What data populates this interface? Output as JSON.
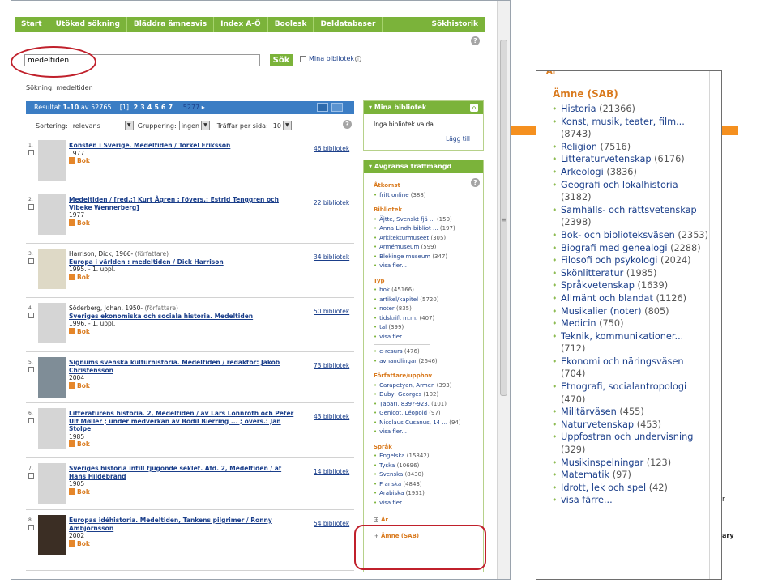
{
  "nav": [
    "Start",
    "Utökad sökning",
    "Bläddra ämnesvis",
    "Index A-Ö",
    "Boolesk",
    "Deldatabaser"
  ],
  "nav_history": "Sökhistorik",
  "search": {
    "value": "medeltiden",
    "button": "Sök",
    "mylib_link": "Mina bibliotek"
  },
  "search_summary": "Sökning: medeltiden",
  "results_header": {
    "prefix": "Resultat",
    "range": "1-10",
    "of": "av",
    "total": "52765",
    "current_page": "[1]",
    "pages": [
      "2",
      "3",
      "4",
      "5",
      "6",
      "7"
    ],
    "ellipsis": "...",
    "last": "5277",
    "next": "▸"
  },
  "sort_bar": {
    "sort_label": "Sortering:",
    "sort_value": "relevans",
    "group_label": "Gruppering:",
    "group_value": "ingen",
    "per_page_label": "Träffar per sida:",
    "per_page_value": "10"
  },
  "results": [
    {
      "num": "1.",
      "author": "",
      "role": "",
      "title": "Konsten i Sverige. Medeltiden / Torkel Eriksson",
      "line": "1977",
      "type": "Bok",
      "libs": "46 bibliotek"
    },
    {
      "num": "2.",
      "author": "",
      "role": "",
      "title": "Medeltiden / [red.:] Kurt Ågren ; [övers.: Estrid Tenggren och Vibeke Wennerberg]",
      "line": "1977",
      "type": "Bok",
      "libs": "22 bibliotek"
    },
    {
      "num": "3.",
      "author": "Harrison, Dick, 1966-",
      "role": "(författare)",
      "title": "Europa i världen : medeltiden / Dick Harrison",
      "line": "1995. - 1. uppl.",
      "type": "Bok",
      "libs": "34 bibliotek"
    },
    {
      "num": "4.",
      "author": "Söderberg, Johan, 1950-",
      "role": "(författare)",
      "title": "Sveriges ekonomiska och sociala historia. Medeltiden",
      "line": "1996. - 1. uppl.",
      "type": "Bok",
      "libs": "50 bibliotek"
    },
    {
      "num": "5.",
      "author": "",
      "role": "",
      "title": "Signums svenska kulturhistoria. Medeltiden / redaktör: Jakob Christensson",
      "line": "2004",
      "type": "Bok",
      "libs": "73 bibliotek"
    },
    {
      "num": "6.",
      "author": "",
      "role": "",
      "title": "Litteraturens historia. 2, Medeltiden / av Lars Lönnroth och Peter Ulf Møller ; under medverkan av Bodil Bierring ... ; övers.: Jan Stolpe",
      "line": "1985",
      "type": "Bok",
      "libs": "43 bibliotek"
    },
    {
      "num": "7.",
      "author": "",
      "role": "",
      "title": "Sveriges historia intill tjugonde seklet. Afd. 2, Medeltiden / af Hans Hildebrand",
      "line": "1905",
      "type": "Bok",
      "libs": "14 bibliotek"
    },
    {
      "num": "8.",
      "author": "",
      "role": "",
      "title": "Europas idéhistoria. Medeltiden, Tankens pilgrimer / Ronny Ambjörnsson",
      "line": "2002",
      "type": "Bok",
      "libs": "54 bibliotek"
    }
  ],
  "mylibs": {
    "title": "Mina bibliotek",
    "body": "Inga bibliotek valda",
    "add": "Lägg till"
  },
  "refine": {
    "title": "Avgränsa träffmängd",
    "groups": [
      {
        "heading": "Åtkomst",
        "items": [
          {
            "label": "fritt online",
            "count": "(388)"
          }
        ]
      },
      {
        "heading": "Bibliotek",
        "items": [
          {
            "label": "Äjtte, Svenskt fjä ...",
            "count": "(150)"
          },
          {
            "label": "Anna Lindh-bibliot ...",
            "count": "(197)"
          },
          {
            "label": "Arkitekturmuseet",
            "count": "(305)"
          },
          {
            "label": "Armémuseum",
            "count": "(599)"
          },
          {
            "label": "Blekinge museum",
            "count": "(347)"
          },
          {
            "label": "visa fler...",
            "count": ""
          }
        ]
      },
      {
        "heading": "Typ",
        "items": [
          {
            "label": "bok",
            "count": "(45166)"
          },
          {
            "label": "artikel/kapitel",
            "count": "(5720)"
          },
          {
            "label": "noter",
            "count": "(835)"
          },
          {
            "label": "tidskrift m.m.",
            "count": "(407)"
          },
          {
            "label": "tal",
            "count": "(399)"
          },
          {
            "label": "visa fler...",
            "count": ""
          }
        ],
        "extra": [
          {
            "label": "e-resurs",
            "count": "(476)"
          },
          {
            "label": "avhandlingar",
            "count": "(2646)"
          }
        ]
      },
      {
        "heading": "Författare/upphov",
        "items": [
          {
            "label": "Carapetyan, Armen",
            "count": "(393)"
          },
          {
            "label": "Duby, Georges",
            "count": "(102)"
          },
          {
            "label": "Ṭabarī, 839?-923.",
            "count": "(101)"
          },
          {
            "label": "Genicot, Léopold",
            "count": "(97)"
          },
          {
            "label": "Nicolaus Cusanus, 14 ...",
            "count": "(94)"
          },
          {
            "label": "visa fler...",
            "count": ""
          }
        ]
      },
      {
        "heading": "Språk",
        "items": [
          {
            "label": "Engelska",
            "count": "(15842)"
          },
          {
            "label": "Tyska",
            "count": "(10696)"
          },
          {
            "label": "Svenska",
            "count": "(8430)"
          },
          {
            "label": "Franska",
            "count": "(4843)"
          },
          {
            "label": "Arabiska",
            "count": "(1931)"
          },
          {
            "label": "visa fler...",
            "count": ""
          }
        ]
      }
    ],
    "collapsed": [
      "År",
      "Ämne (SAB)"
    ]
  },
  "zoom": {
    "year_label": "År",
    "title": "Ämne (SAB)",
    "items": [
      {
        "label": "Historia",
        "count": "(21366)"
      },
      {
        "label": "Konst, musik, teater, film...",
        "count": "(8743)"
      },
      {
        "label": "Religion",
        "count": "(7516)"
      },
      {
        "label": "Litteraturvetenskap",
        "count": "(6176)"
      },
      {
        "label": "Arkeologi",
        "count": "(3836)"
      },
      {
        "label": "Geografi och lokalhistoria",
        "count": "(3182)"
      },
      {
        "label": "Samhälls- och rättsvetenskap",
        "count": "(2398)"
      },
      {
        "label": "Bok- och biblioteksväsen",
        "count": "(2353)"
      },
      {
        "label": "Biografi med genealogi",
        "count": "(2288)"
      },
      {
        "label": "Filosofi och psykologi",
        "count": "(2024)"
      },
      {
        "label": "Skönlitteratur",
        "count": "(1985)"
      },
      {
        "label": "Språkvetenskap",
        "count": "(1639)"
      },
      {
        "label": "Allmänt och blandat",
        "count": "(1126)"
      },
      {
        "label": "Musikalier (noter)",
        "count": "(805)"
      },
      {
        "label": "Medicin",
        "count": "(750)"
      },
      {
        "label": "Teknik, kommunikationer...",
        "count": "(712)"
      },
      {
        "label": "Ekonomi och näringsväsen",
        "count": "(704)"
      },
      {
        "label": "Etnografi, socialantropologi",
        "count": "(470)"
      },
      {
        "label": "Militärväsen",
        "count": "(455)"
      },
      {
        "label": "Naturvetenskap",
        "count": "(453)"
      },
      {
        "label": "Uppfostran och undervisning",
        "count": "(329)"
      },
      {
        "label": "Musikinspelningar",
        "count": "(123)"
      },
      {
        "label": "Matematik",
        "count": "(97)"
      },
      {
        "label": "Idrott, lek och spel",
        "count": "(42)"
      }
    ],
    "less": "visa färre..."
  },
  "background_text": {
    "side_y": "r",
    "side_ary": "ary"
  },
  "colors": {
    "nav_green": "#7bb33a",
    "header_blue": "#3b7dc4",
    "facet_orange": "#d97a1e",
    "link_blue": "#1a3e8a",
    "highlight_red": "#c0202b",
    "slide_orange": "#f5901f"
  }
}
